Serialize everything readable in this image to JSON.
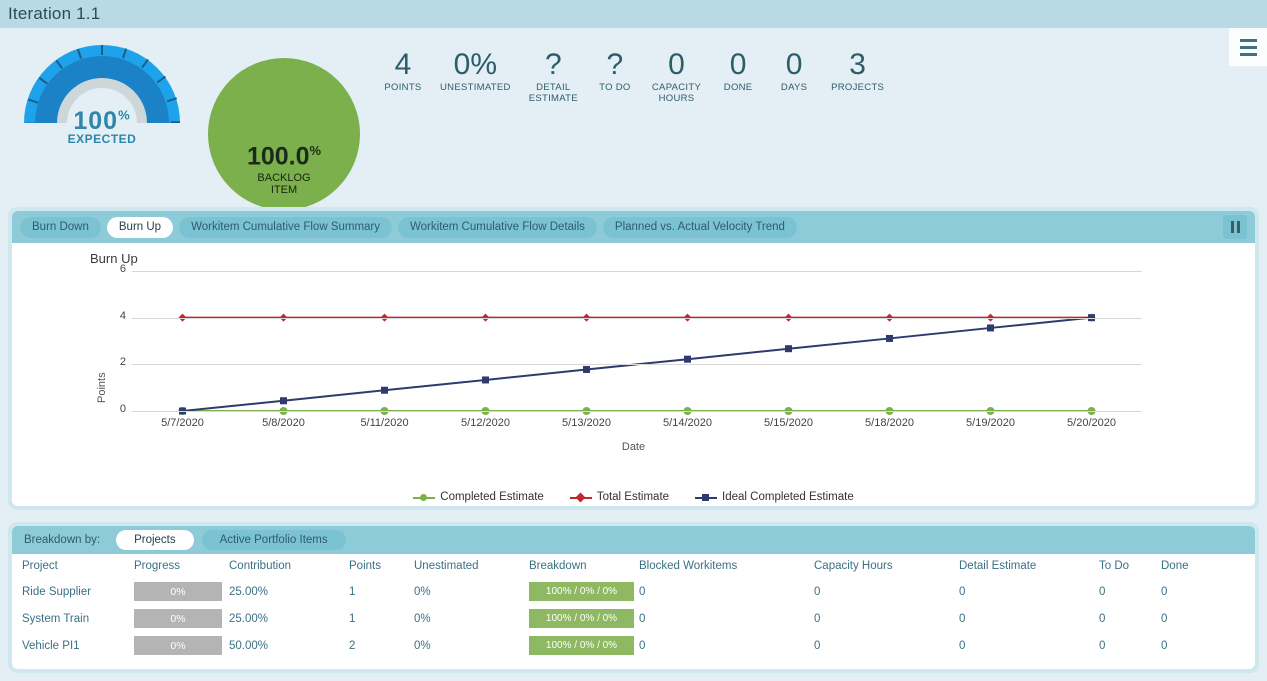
{
  "header": {
    "title": "Iteration 1.1",
    "menu_icon": "hamburger-icon"
  },
  "gauge": {
    "value": "100",
    "unit": "%",
    "label": "EXPECTED",
    "outer_color": "#1fa2ec",
    "mid_color": "#1c82c8",
    "track_color": "#cdd6d9"
  },
  "bubble": {
    "value": "100.0",
    "unit": "%",
    "label_line1": "BACKLOG",
    "label_line2": "ITEM",
    "color": "#7cb04d"
  },
  "metrics": [
    {
      "value": "4",
      "label": "POINTS"
    },
    {
      "value": "0%",
      "label": "UNESTIMATED"
    },
    {
      "value": "?",
      "label": "DETAIL\nESTIMATE"
    },
    {
      "value": "?",
      "label": "TO DO"
    },
    {
      "value": "0",
      "label": "CAPACITY\nHOURS"
    },
    {
      "value": "0",
      "label": "DONE"
    },
    {
      "value": "0",
      "label": "DAYS"
    },
    {
      "value": "3",
      "label": "PROJECTS"
    }
  ],
  "chart_panel": {
    "tabs": [
      {
        "label": "Burn Down",
        "active": false
      },
      {
        "label": "Burn Up",
        "active": true
      },
      {
        "label": "Workitem Cumulative Flow Summary",
        "active": false
      },
      {
        "label": "Workitem Cumulative Flow Details",
        "active": false
      },
      {
        "label": "Planned vs. Actual Velocity Trend",
        "active": false
      }
    ],
    "pause_icon": "pause-icon"
  },
  "chart_data": {
    "type": "line",
    "title": "Burn Up",
    "xlabel": "Date",
    "ylabel": "Points",
    "ylim": [
      0,
      6
    ],
    "yticks": [
      0,
      2,
      4,
      6
    ],
    "grid": true,
    "legend_position": "bottom",
    "categories": [
      "5/7/2020",
      "5/8/2020",
      "5/11/2020",
      "5/12/2020",
      "5/13/2020",
      "5/14/2020",
      "5/15/2020",
      "5/18/2020",
      "5/19/2020",
      "5/20/2020"
    ],
    "x": [
      "5/7/2020",
      "5/8/2020",
      "5/11/2020",
      "5/12/2020",
      "5/13/2020",
      "5/14/2020",
      "5/15/2020",
      "5/18/2020",
      "5/19/2020",
      "5/20/2020"
    ],
    "series": [
      {
        "name": "Completed Estimate",
        "color": "#7cb04d",
        "marker": "circle",
        "values": [
          0,
          0,
          0,
          0,
          0,
          0,
          0,
          0,
          0,
          0
        ]
      },
      {
        "name": "Total Estimate",
        "color": "#c1272d",
        "marker": "diamond",
        "values": [
          4,
          4,
          4,
          4,
          4,
          4,
          4,
          4,
          4,
          4
        ]
      },
      {
        "name": "Ideal Completed Estimate",
        "color": "#2f3b6e",
        "marker": "square",
        "values": [
          0,
          0.44,
          0.89,
          1.33,
          1.78,
          2.22,
          2.67,
          3.11,
          3.56,
          4
        ]
      }
    ]
  },
  "table_panel": {
    "breakdown_label": "Breakdown by:",
    "toggles": [
      {
        "label": "Projects",
        "active": true
      },
      {
        "label": "Active Portfolio Items",
        "active": false
      }
    ],
    "columns": [
      "Project",
      "Progress",
      "Contribution",
      "Points",
      "Unestimated",
      "Breakdown",
      "Blocked Workitems",
      "Capacity Hours",
      "Detail Estimate",
      "To Do",
      "Done"
    ],
    "rows": [
      {
        "project": "Ride Supplier",
        "progress": "0%",
        "contribution": "25.00%",
        "points": "1",
        "unestimated": "0%",
        "breakdown": "100% / 0% / 0%",
        "blocked": "0",
        "capacity": "0",
        "detail": "0",
        "todo": "0",
        "done": "0"
      },
      {
        "project": "System Train",
        "progress": "0%",
        "contribution": "25.00%",
        "points": "1",
        "unestimated": "0%",
        "breakdown": "100% / 0% / 0%",
        "blocked": "0",
        "capacity": "0",
        "detail": "0",
        "todo": "0",
        "done": "0"
      },
      {
        "project": "Vehicle PI1",
        "progress": "0%",
        "contribution": "50.00%",
        "points": "2",
        "unestimated": "0%",
        "breakdown": "100% / 0% / 0%",
        "blocked": "0",
        "capacity": "0",
        "detail": "0",
        "todo": "0",
        "done": "0"
      }
    ]
  }
}
